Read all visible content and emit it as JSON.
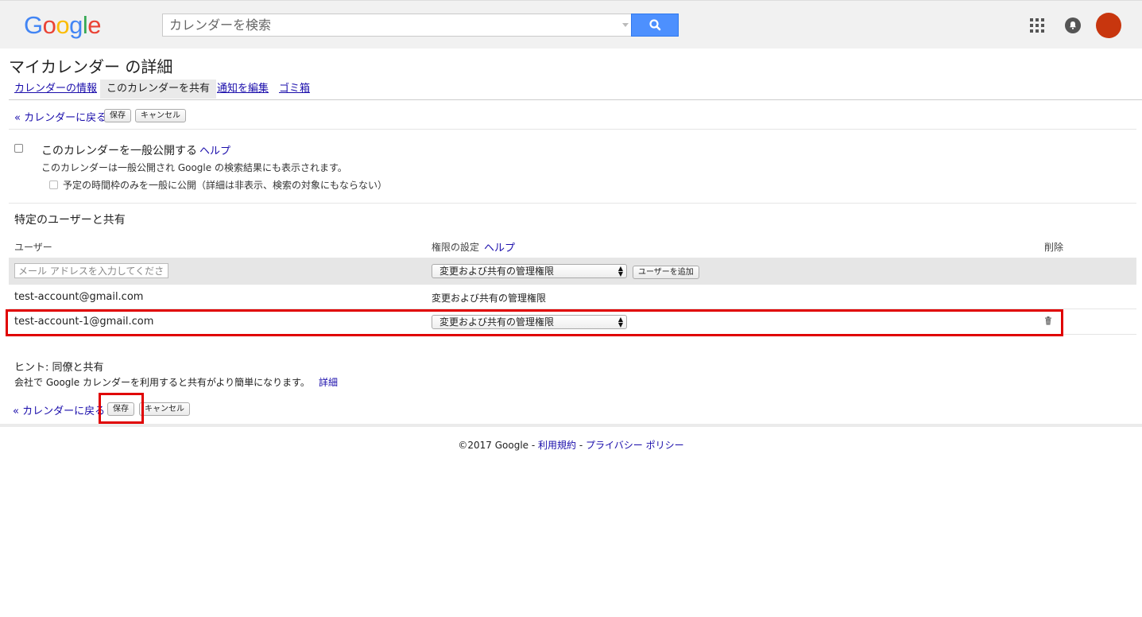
{
  "header": {
    "logo": "Google",
    "search_placeholder": "カレンダーを検索"
  },
  "page_title": "マイカレンダー の詳細",
  "tabs": [
    {
      "label": "カレンダーの情報",
      "active": false
    },
    {
      "label": "このカレンダーを共有",
      "active": true
    },
    {
      "label": "通知を編集",
      "active": false
    },
    {
      "label": "ゴミ箱",
      "active": false
    }
  ],
  "actions_top": {
    "back": "« カレンダーに戻る",
    "save": "保存",
    "cancel": "キャンセル"
  },
  "public": {
    "label": "このカレンダーを一般公開する",
    "help": "ヘルプ",
    "description": "このカレンダーは一般公開され Google の検索結果にも表示されます。",
    "free_busy_label": "予定の時間枠のみを一般に公開（詳細は非表示、検索の対象にもならない）"
  },
  "share_specific": {
    "title": "特定のユーザーと共有",
    "col_user": "ユーザー",
    "col_permission": "権限の設定",
    "col_permission_help": "ヘルプ",
    "col_delete": "削除",
    "email_placeholder": "メール アドレスを入力してくださ",
    "new_permission": "変更および共有の管理権限",
    "add_user_button": "ユーザーを追加",
    "rows": [
      {
        "email": "test-account@gmail.com",
        "permission": "変更および共有の管理権限"
      },
      {
        "email": "test-account-1@gmail.com",
        "permission": "変更および共有の管理権限"
      }
    ]
  },
  "hint": {
    "title": "ヒント: 同僚と共有",
    "text": "会社で Google カレンダーを利用すると共有がより簡単になります。",
    "link": "詳細"
  },
  "actions_bottom": {
    "back": "« カレンダーに戻る",
    "save": "保存",
    "cancel": "キャンセル"
  },
  "footer": {
    "copyright": "©2017 Google",
    "sep1": "-",
    "terms": "利用規約",
    "sep2": "-",
    "privacy": "プライバシー ポリシー"
  },
  "colors": {
    "highlight": "#e00000",
    "search_button": "#4d90fe",
    "avatar": "#c8360e"
  }
}
